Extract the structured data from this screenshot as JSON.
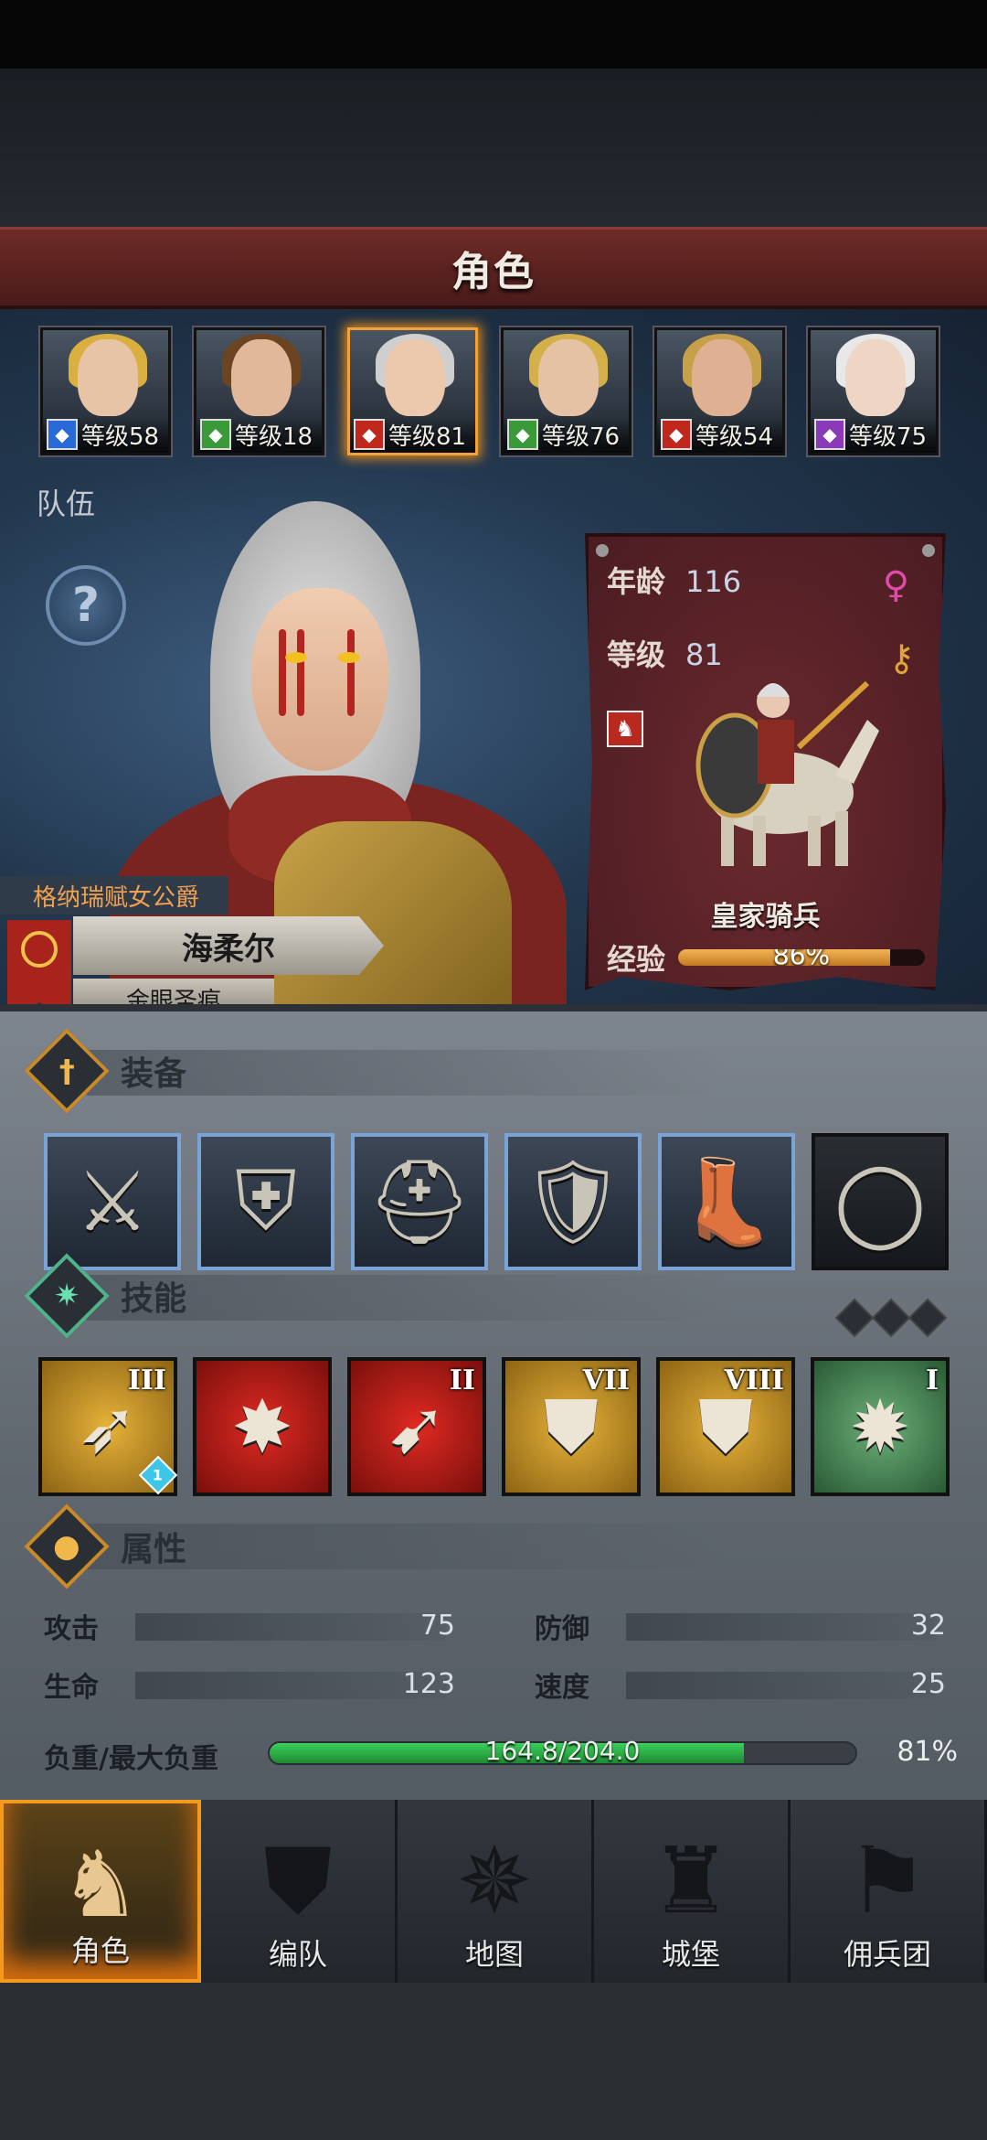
{
  "header": {
    "title": "角色"
  },
  "roster": [
    {
      "class_icon": "sword-class-icon",
      "class_color": "#2a6ad8",
      "level": "等级58",
      "hair": "#d9b040",
      "skin": "#e8c4a6"
    },
    {
      "class_icon": "bow-class-icon",
      "class_color": "#3a9a3a",
      "level": "等级18",
      "hair": "#6b4522",
      "skin": "#e2b89a"
    },
    {
      "class_icon": "cavalry-class-icon",
      "class_color": "#c0281e",
      "level": "等级81",
      "hair": "#cfcfcf",
      "skin": "#ecc8ac",
      "selected": true
    },
    {
      "class_icon": "bow-class-icon",
      "class_color": "#3a9a3a",
      "level": "等级76",
      "hair": "#d4b04a",
      "skin": "#e6c2a4"
    },
    {
      "class_icon": "cavalry-class-icon",
      "class_color": "#c0281e",
      "level": "等级54",
      "hair": "#c9a04a",
      "skin": "#e0b092"
    },
    {
      "class_icon": "staff-class-icon",
      "class_color": "#8a3ab8",
      "level": "等级75",
      "hair": "#e8e8e8",
      "skin": "#efd6c4"
    }
  ],
  "team_label": "队伍",
  "hero": {
    "title": "格纳瑞赋女公爵",
    "name": "海柔尔",
    "epithet": "金眼圣痕"
  },
  "info": {
    "age_label": "年龄",
    "age": "116",
    "level_label": "等级",
    "level": "81",
    "class_name": "皇家骑兵",
    "exp_label": "经验",
    "exp_text": "86%",
    "exp_fraction": 0.86
  },
  "sections": {
    "equipment": "装备",
    "skills": "技能",
    "attributes": "属性"
  },
  "equipment": [
    {
      "icon": "sword-icon",
      "glyph": "⚔"
    },
    {
      "icon": "shield-icon",
      "glyph": "⛨"
    },
    {
      "icon": "helmet-icon",
      "glyph": "⛑"
    },
    {
      "icon": "chest-armor-icon",
      "glyph": "🛡"
    },
    {
      "icon": "boots-icon",
      "glyph": "👢"
    },
    {
      "icon": "ring-icon",
      "glyph": "◯"
    }
  ],
  "skills": [
    {
      "rank": "III",
      "color": "yellow",
      "icon": "crossbow-skill-icon",
      "glyph": "➶",
      "gem": "1"
    },
    {
      "rank": "",
      "color": "red",
      "icon": "strike-skill-icon",
      "glyph": "✸"
    },
    {
      "rank": "II",
      "color": "red",
      "icon": "arrow-skill-icon",
      "glyph": "➹"
    },
    {
      "rank": "VII",
      "color": "yellow",
      "icon": "shield-bash-skill-icon",
      "glyph": "⛊"
    },
    {
      "rank": "VIII",
      "color": "yellow",
      "icon": "shield-bash-skill-icon",
      "glyph": "⛊"
    },
    {
      "rank": "I",
      "color": "green",
      "icon": "burst-skill-icon",
      "glyph": "✹"
    }
  ],
  "attributes": {
    "attack_label": "攻击",
    "attack": "75",
    "defense_label": "防御",
    "defense": "32",
    "hp_label": "生命",
    "hp": "123",
    "speed_label": "速度",
    "speed": "25",
    "load_label": "负重/最大负重",
    "load_text": "164.8/204.0",
    "load_pct": "81%",
    "load_fraction": 0.81
  },
  "nav": [
    {
      "label": "角色",
      "icon": "knight-icon",
      "glyph": "♞",
      "active": true
    },
    {
      "label": "编队",
      "icon": "formation-icon",
      "glyph": "⛊"
    },
    {
      "label": "地图",
      "icon": "compass-icon",
      "glyph": "✵"
    },
    {
      "label": "城堡",
      "icon": "castle-icon",
      "glyph": "♜"
    },
    {
      "label": "佣兵团",
      "icon": "mercenary-icon",
      "glyph": "⚑"
    }
  ]
}
